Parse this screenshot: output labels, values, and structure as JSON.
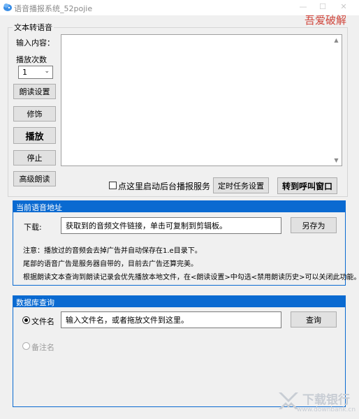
{
  "window": {
    "title": "语音播报系统_52pojie",
    "brand": "吾爱破解"
  },
  "tts_group": {
    "label": "文本转语音",
    "input_label": "输入内容：",
    "play_count_label": "播放次数",
    "play_count_value": "1",
    "buttons": {
      "read_settings": "朗读设置",
      "modify": "修饰",
      "play": "播放",
      "stop": "停止",
      "advanced_read": "高级朗读",
      "timer_settings": "定时任务设置",
      "goto_call": "转到呼叫窗口"
    },
    "background_service_label": "点这里启动后台播报服务"
  },
  "voice_url": {
    "header": "当前语音地址",
    "download_label": "下载:",
    "url_field": "获取到的音频文件链接，单击可复制到剪辑板。",
    "save_as": "另存为",
    "notes": [
      "注意：播放过的音频会去掉广告并自动保存在1.e目录下。",
      "尾部的语音广告是服务器自带的，目前去广告还算完美。",
      "根据朗读文本查询到朗读记录会优先播放本地文件，在<朗读设置>中勾选<禁用朗读历史>可以关闭此功能。"
    ]
  },
  "db_query": {
    "header": "数据库查询",
    "radio_filename": "文件名",
    "radio_note": "备注名",
    "search_field": "输入文件名，或者拖放文件到这里。",
    "query_button": "查询"
  },
  "watermark": {
    "text": "下载银行",
    "sub": "www.downbank.cn"
  },
  "colors": {
    "accent_blue": "#0a6ad1",
    "brand_red": "#d0453b"
  }
}
